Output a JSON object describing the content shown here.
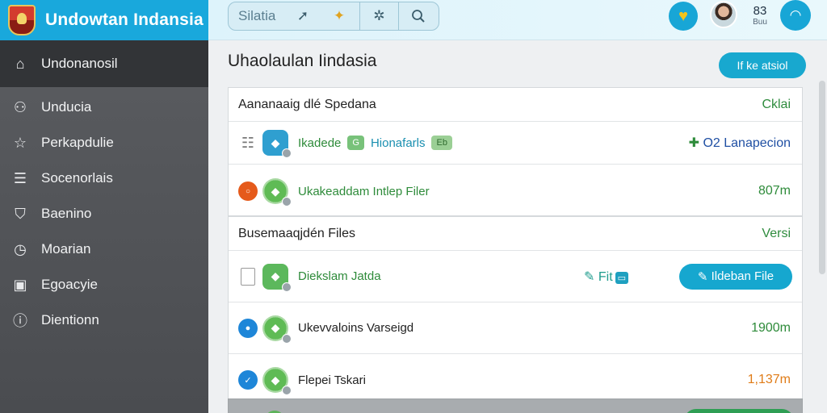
{
  "app": {
    "title": "Undowtan Indansia"
  },
  "toolbar": {
    "search_label": "Silatia"
  },
  "user": {
    "count": "83",
    "sub": "Buu"
  },
  "sidebar": {
    "header": "Undonanosil",
    "items": [
      {
        "label": "Unducia",
        "icon": "user-icon"
      },
      {
        "label": "Perkapdulie",
        "icon": "star-icon"
      },
      {
        "label": "Socenorlais",
        "icon": "list-icon"
      },
      {
        "label": "Baenino",
        "icon": "shield-icon"
      },
      {
        "label": "Moarian",
        "icon": "clock-icon"
      },
      {
        "label": "Egoacyie",
        "icon": "box-icon"
      },
      {
        "label": "Dientionn",
        "icon": "info-icon"
      }
    ]
  },
  "main": {
    "title": "Uhaolaulan Iindasia",
    "top_action": "If ke atsiol",
    "section1": {
      "header": "Aananaaig dlé Spedana",
      "header_right": "Cklai",
      "rows": [
        {
          "label": "Ikadede",
          "tag1": "G",
          "tag2": "Hionafarls",
          "tag3": "Eb",
          "right": "O2 Lanapecion"
        },
        {
          "label": "Ukakeaddam Intlep Filer",
          "right": "807m"
        }
      ]
    },
    "section2": {
      "header": "Busemaaqjdén Files",
      "header_right": "Versi",
      "rows": [
        {
          "label": "Diekslam Jatda",
          "fit": "Fit",
          "button": "Ildeban File"
        },
        {
          "label": "Ukevvaloins Varseigd",
          "right": "1900m"
        },
        {
          "label": "Flepei Tskari",
          "right": "1,137m"
        }
      ]
    }
  },
  "colors": {
    "brand": "#19a8dc",
    "sidebar": "#4a4c50",
    "accent_button": "#16a7cf",
    "text_green": "#2e8b3a"
  }
}
